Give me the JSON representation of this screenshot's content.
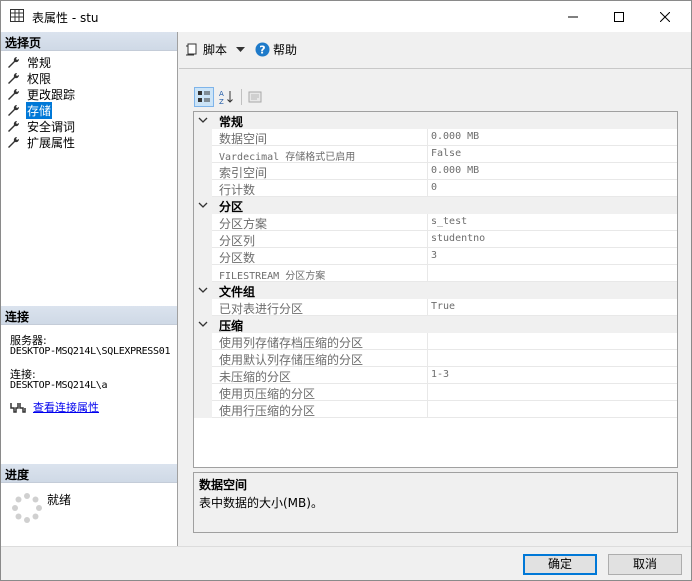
{
  "window": {
    "title": "表属性 - stu",
    "icon": "table-icon",
    "minimize_icon": "minimize-icon",
    "maximize_icon": "maximize-icon",
    "close_icon": "close-icon"
  },
  "left_panel": {
    "select_page_header": "选择页",
    "pages": [
      {
        "label": "常规",
        "icon": "wrench-icon",
        "active": false
      },
      {
        "label": "权限",
        "icon": "wrench-icon",
        "active": false
      },
      {
        "label": "更改跟踪",
        "icon": "wrench-icon",
        "active": false
      },
      {
        "label": "存储",
        "icon": "wrench-icon",
        "active": true
      },
      {
        "label": "安全谓词",
        "icon": "wrench-icon",
        "active": false
      },
      {
        "label": "扩展属性",
        "icon": "wrench-icon",
        "active": false
      }
    ],
    "connection": {
      "header": "连接",
      "server_label": "服务器:",
      "server_value": "DESKTOP-MSQ214L\\SQLEXPRESS01",
      "conn_label": "连接:",
      "conn_value": "DESKTOP-MSQ214L\\a",
      "view_link": "查看连接属性",
      "link_icon": "connection-properties-icon"
    },
    "progress": {
      "header": "进度",
      "status": "就绪",
      "spinner_icon": "progress-spinner-icon"
    }
  },
  "toolbar": {
    "script_label": "脚本",
    "script_icon": "script-icon",
    "help_label": "帮助",
    "help_icon": "help-icon"
  },
  "sort_buttons": {
    "categorized_icon": "categorized-icon",
    "alphabetical_icon": "alphabetical-sort-icon",
    "property_pages_icon": "property-pages-icon"
  },
  "grid": {
    "categories": [
      {
        "name": "常规",
        "props": [
          {
            "name": "数据空间",
            "value": "0.000 MB"
          },
          {
            "name": "Vardecimal 存储格式已启用",
            "value": "False"
          },
          {
            "name": "索引空间",
            "value": "0.000 MB"
          },
          {
            "name": "行计数",
            "value": "0"
          }
        ]
      },
      {
        "name": "分区",
        "props": [
          {
            "name": "分区方案",
            "value": "s_test"
          },
          {
            "name": "分区列",
            "value": "studentno"
          },
          {
            "name": "分区数",
            "value": "3"
          },
          {
            "name": "FILESTREAM 分区方案",
            "value": ""
          }
        ]
      },
      {
        "name": "文件组",
        "props": [
          {
            "name": "已对表进行分区",
            "value": "True"
          }
        ]
      },
      {
        "name": "压缩",
        "props": [
          {
            "name": "使用列存储存档压缩的分区",
            "value": ""
          },
          {
            "name": "使用默认列存储压缩的分区",
            "value": ""
          },
          {
            "name": "未压缩的分区",
            "value": "1-3"
          },
          {
            "name": "使用页压缩的分区",
            "value": ""
          },
          {
            "name": "使用行压缩的分区",
            "value": ""
          }
        ]
      }
    ]
  },
  "description": {
    "title": "数据空间",
    "body": "表中数据的大小(MB)。"
  },
  "buttons": {
    "ok": "确定",
    "cancel": "取消"
  },
  "colors": {
    "accent": "#0078d7",
    "header_bg": "#d4dde9"
  }
}
